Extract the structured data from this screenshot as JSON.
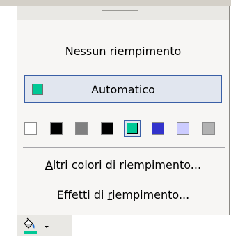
{
  "menu": {
    "no_fill_label": "Nessun riempimento",
    "automatic_label": "Automatico",
    "more_colors_label_accel": "A",
    "more_colors_label_rest": "ltri colori di riempimento...",
    "fill_effects_label_pre": "Effetti di ",
    "fill_effects_label_accel": "r",
    "fill_effects_label_post": "iempimento..."
  },
  "automatic_color": "#00c896",
  "palette": [
    {
      "color": "#ffffff",
      "selected": false
    },
    {
      "color": "#000000",
      "selected": false
    },
    {
      "color": "#808080",
      "selected": false
    },
    {
      "color": "#000000",
      "selected": false
    },
    {
      "color": "#00c896",
      "selected": true
    },
    {
      "color": "#3333cc",
      "selected": false
    },
    {
      "color": "#ccccff",
      "selected": false
    },
    {
      "color": "#b2b2b2",
      "selected": false
    }
  ],
  "toolbar": {
    "fill_color_icon": "paint-bucket-icon",
    "fill_color_bar_color": "#00c896",
    "dropdown_icon": "chevron-down-icon"
  }
}
